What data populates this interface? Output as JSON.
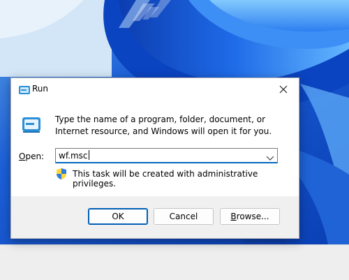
{
  "dialog": {
    "title": "Run",
    "description": "Type the name of a program, folder, document, or Internet resource, and Windows will open it for you.",
    "open_label_accel": "O",
    "open_label_rest": "pen:",
    "open_value": "wf.msc",
    "admin_note": "This task will be created with administrative privileges.",
    "buttons": {
      "ok": "OK",
      "cancel": "Cancel",
      "browse_accel": "B",
      "browse_rest": "rowse..."
    }
  },
  "icons": {
    "title": "run-icon",
    "app": "run-icon",
    "close": "close-icon",
    "dropdown": "chevron-down-icon",
    "shield": "uac-shield-icon"
  },
  "colors": {
    "desktop_bg": "#0a48c8",
    "accent": "#005fb8",
    "button_bar": "#f0f0f0",
    "taskbar": "#eeeeee"
  }
}
